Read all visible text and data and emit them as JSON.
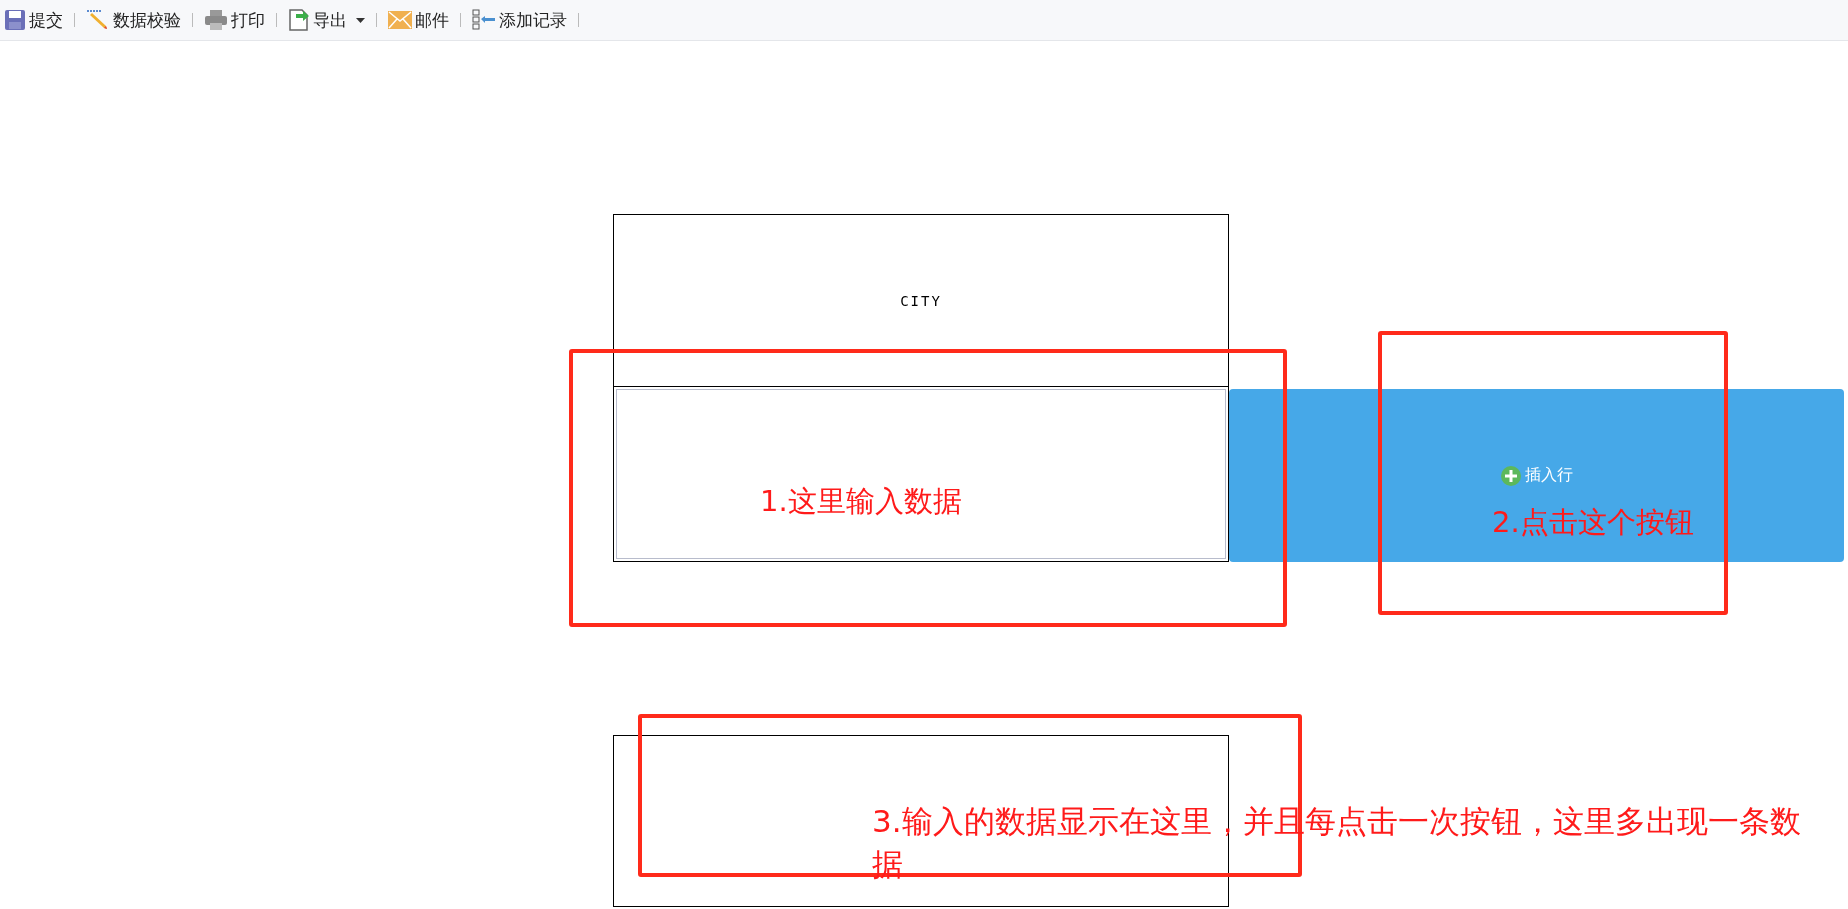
{
  "toolbar": {
    "items": [
      {
        "kind": "save",
        "label": "提交",
        "dropdown": false
      },
      {
        "kind": "validate",
        "label": "数据校验",
        "dropdown": false
      },
      {
        "kind": "print",
        "label": "打印",
        "dropdown": false
      },
      {
        "kind": "export",
        "label": "导出",
        "dropdown": true
      },
      {
        "kind": "mail",
        "label": "邮件",
        "dropdown": false
      },
      {
        "kind": "add-record",
        "label": "添加记录",
        "dropdown": false
      }
    ]
  },
  "table": {
    "header": "CITY"
  },
  "insert_button": {
    "label": "插入行"
  },
  "annotations": [
    {
      "text": "1.这里输入数据"
    },
    {
      "text": "2.点击这个按钮"
    },
    {
      "text": "3.输入的数据显示在这里，并且每点击一次按钮，这里多出现一条数据"
    }
  ]
}
